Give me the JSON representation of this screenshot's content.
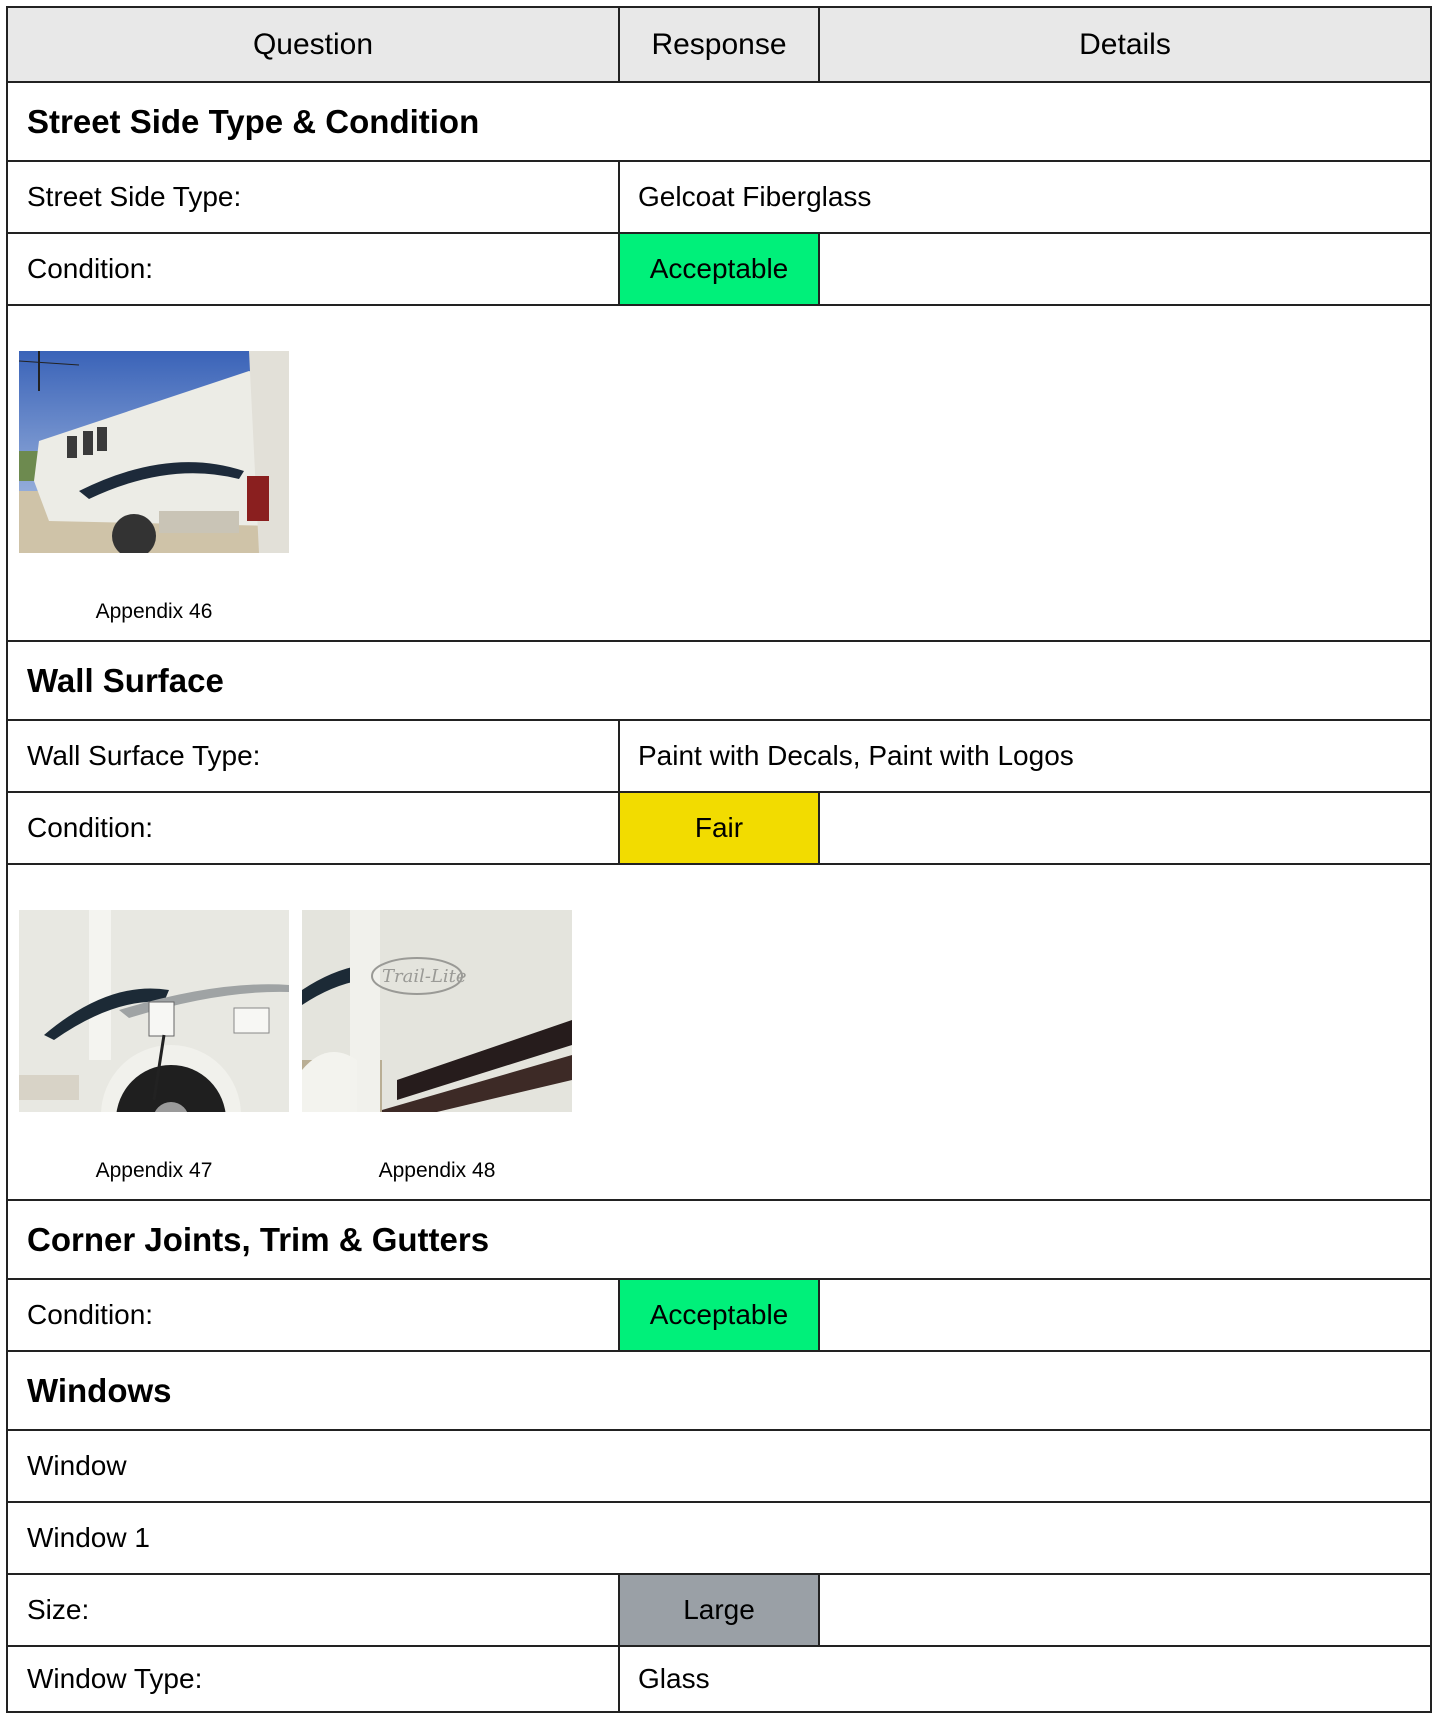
{
  "header": {
    "question": "Question",
    "response": "Response",
    "details": "Details"
  },
  "sections": [
    {
      "title": "Street Side Type & Condition",
      "rows": [
        {
          "question": "Street Side Type:",
          "response": "Gelcoat Fiberglass"
        },
        {
          "question": "Condition:",
          "response": "Acceptable",
          "response_color": "#00f07a"
        }
      ],
      "photos": [
        {
          "caption": "Appendix 46",
          "icon": "rv-street-side-photo"
        }
      ]
    },
    {
      "title": "Wall Surface",
      "rows": [
        {
          "question": "Wall Surface Type:",
          "response": "Paint with Decals, Paint with Logos"
        },
        {
          "question": "Condition:",
          "response": "Fair",
          "response_color": "#f2dc00"
        }
      ],
      "photos": [
        {
          "caption": "Appendix 47",
          "icon": "rv-wall-wheel-photo"
        },
        {
          "caption": "Appendix 48",
          "icon": "rv-wall-logo-photo"
        }
      ]
    },
    {
      "title": "Corner Joints, Trim & Gutters",
      "rows": [
        {
          "question": "Condition:",
          "response": "Acceptable",
          "response_color": "#00f07a"
        }
      ]
    },
    {
      "title": "Windows",
      "lines": [
        "Window",
        "Window 1"
      ],
      "rows": [
        {
          "question": "Size:",
          "response": "Large",
          "response_color": "#9aa0a6"
        },
        {
          "question": "Window Type:",
          "response": "Glass"
        }
      ]
    }
  ]
}
